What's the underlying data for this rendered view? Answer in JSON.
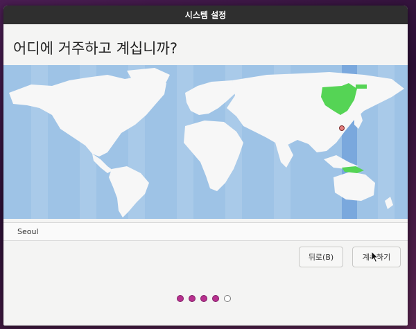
{
  "window": {
    "title": "시스템 설정"
  },
  "page": {
    "question": "어디에 거주하고 계십니까?"
  },
  "timezone_map": {
    "ocean_color": "#9ec3e6",
    "highlight_band_color": "#7aa8dd",
    "land_color": "#f7f7f7",
    "selected_zone_color": "#55d455",
    "marker_color": "#e27d7d"
  },
  "location": {
    "city": "Seoul"
  },
  "buttons": {
    "back": "뒤로(B)",
    "continue": "계속하기"
  },
  "progress": {
    "total_steps": 5,
    "completed_steps": 4,
    "accent": "#b8318f"
  }
}
